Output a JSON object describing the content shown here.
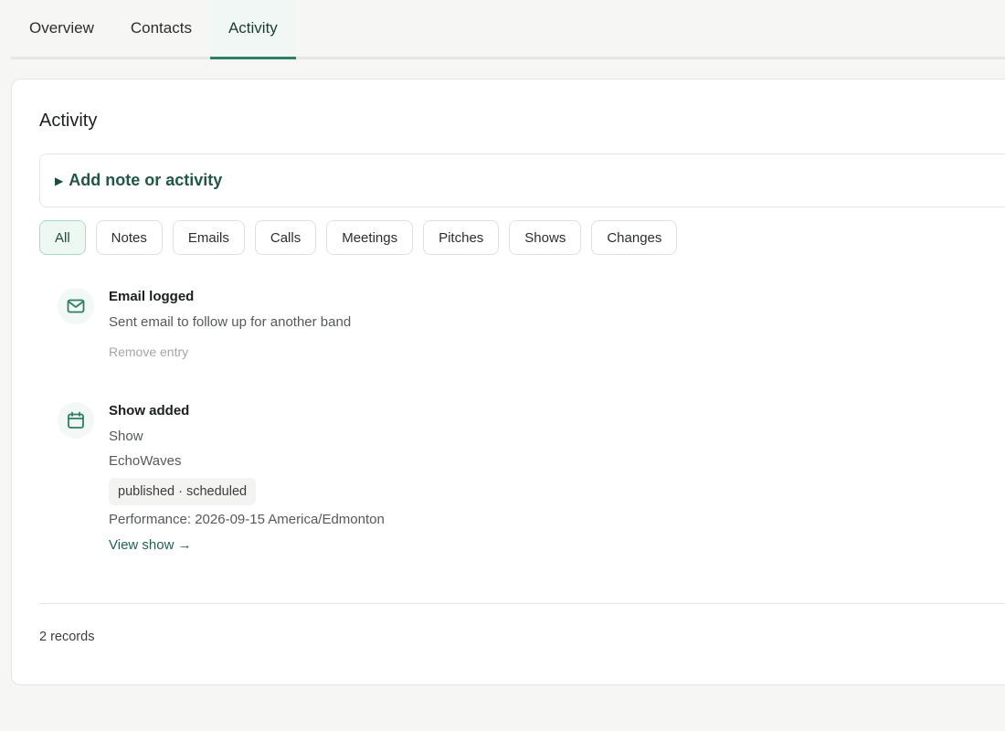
{
  "tabs": [
    {
      "label": "Overview",
      "active": false
    },
    {
      "label": "Contacts",
      "active": false
    },
    {
      "label": "Activity",
      "active": true
    }
  ],
  "activity": {
    "title": "Activity",
    "add_note_label": "Add note or activity",
    "filters": [
      "All",
      "Notes",
      "Emails",
      "Calls",
      "Meetings",
      "Pitches",
      "Shows",
      "Changes"
    ],
    "active_filter": "All",
    "entries": [
      {
        "icon": "mail-icon",
        "title": "Email logged",
        "description": "Sent email to follow up for another band",
        "remove_label": "Remove entry"
      },
      {
        "icon": "calendar-icon",
        "title": "Show added",
        "type_label": "Show",
        "artist": "EchoWaves",
        "status_badge": "published · scheduled",
        "performance": "Performance: 2026-09-15 America/Edmonton",
        "link_label": "View show →"
      }
    ],
    "record_count": "2 records"
  },
  "colors": {
    "accent": "#2f7d63",
    "link": "#226150",
    "active_chip_bg": "#eef8f3",
    "active_chip_border": "#a7dcc4"
  }
}
